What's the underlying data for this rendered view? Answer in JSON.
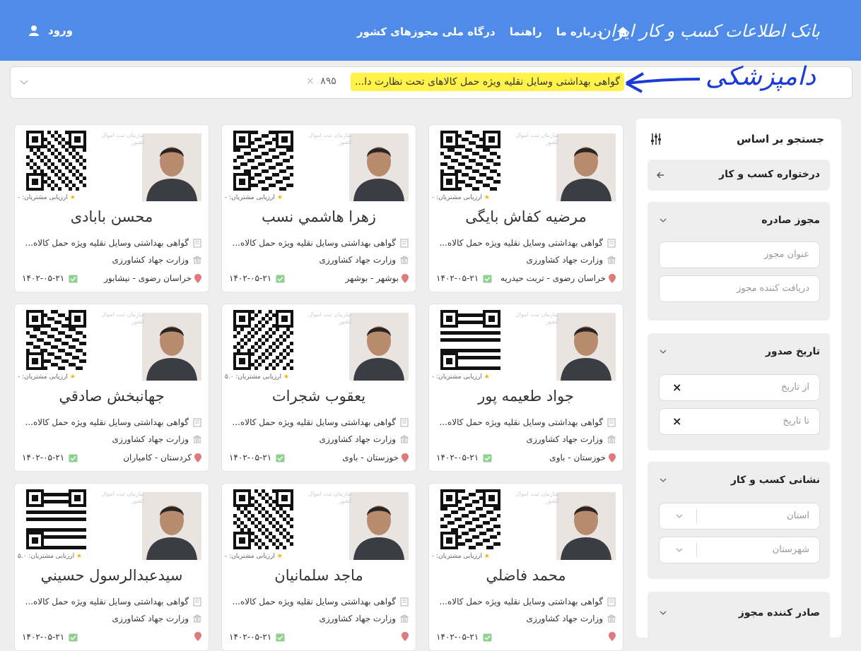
{
  "header": {
    "logo": "بانک اطلاعات کسب و کار ایران",
    "nav": [
      "درباره ما",
      "راهنما",
      "درگاه ملی مجوزهای کشور"
    ],
    "login": "ورود"
  },
  "search": {
    "chip": "گواهی بهداشتی وسایل نقلیه ویژه حمل کالاهای تحت نظارت دا...",
    "count": "۸۹۵"
  },
  "annotation": "دامپزشکی",
  "sidebar": {
    "title": "جستجو بر اساس",
    "request": "درختواره کسب و کار",
    "sections": {
      "license": {
        "label": "مجوز صادره",
        "ph1": "عنوان مجوز",
        "ph2": "دریافت کننده مجوز"
      },
      "date": {
        "label": "تاریخ صدور",
        "ph1": "از تاریخ",
        "ph2": "تا تاریخ"
      },
      "address": {
        "label": "نشانی کسب و کار",
        "ph1": "استان",
        "ph2": "شهرستان"
      },
      "issuer": {
        "label": "صادر کننده مجوز"
      }
    }
  },
  "common": {
    "rating": "ارزیابی مشتریان:",
    "license": "گواهی بهداشتی وسایل نقلیه ویژه حمل کالاه...",
    "ministry": "وزارت جهاد کشاورزی",
    "date": "۱۴۰۲-۰۵-۲۱",
    "watermark": "سازمان ثبت اموال کشور"
  },
  "cards": [
    {
      "name": "مرضیه کفاش بایگی",
      "location": "خراسان رضوی - تربت حیدریه",
      "rating": "-"
    },
    {
      "name": "زهرا هاشمي نسب",
      "location": "بوشهر - بوشهر",
      "rating": "-"
    },
    {
      "name": "محسن بابادی",
      "location": "خراسان رضوی - نیشابور",
      "rating": "-"
    },
    {
      "name": "جواد طعیمه پور",
      "location": "خوزستان - باوی",
      "rating": "-"
    },
    {
      "name": "یعقوب شجرات",
      "location": "خوزستان - باوی",
      "rating": "۵.۰"
    },
    {
      "name": "جهانبخش صادقي",
      "location": "کردستان - کامیاران",
      "rating": "-"
    },
    {
      "name": "محمد فاضلي",
      "location": "",
      "rating": "-"
    },
    {
      "name": "ماجد سلمانیان",
      "location": "",
      "rating": "-"
    },
    {
      "name": "سیدعبدالرسول حسيني",
      "location": "",
      "rating": "۵.۰"
    }
  ]
}
